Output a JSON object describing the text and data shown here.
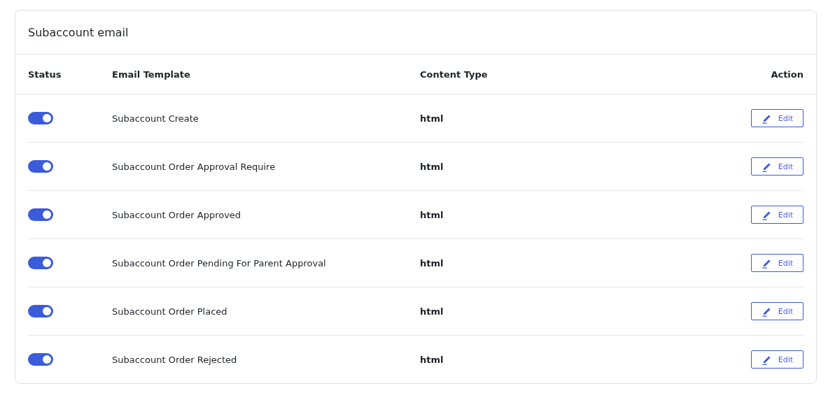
{
  "card": {
    "title": "Subaccount email"
  },
  "table": {
    "columns": [
      "Status",
      "Email Template",
      "Content Type",
      "Action"
    ],
    "rows": [
      {
        "on": true,
        "template": "Subaccount Create",
        "content_type": "html",
        "action": "Edit"
      },
      {
        "on": true,
        "template": "Subaccount Order Approval Require",
        "content_type": "html",
        "action": "Edit"
      },
      {
        "on": true,
        "template": "Subaccount Order Approved",
        "content_type": "html",
        "action": "Edit"
      },
      {
        "on": true,
        "template": "Subaccount Order Pending For Parent Approval",
        "content_type": "html",
        "action": "Edit"
      },
      {
        "on": true,
        "template": "Subaccount Order Placed",
        "content_type": "html",
        "action": "Edit"
      },
      {
        "on": true,
        "template": "Subaccount Order Rejected",
        "content_type": "html",
        "action": "Edit"
      }
    ]
  }
}
